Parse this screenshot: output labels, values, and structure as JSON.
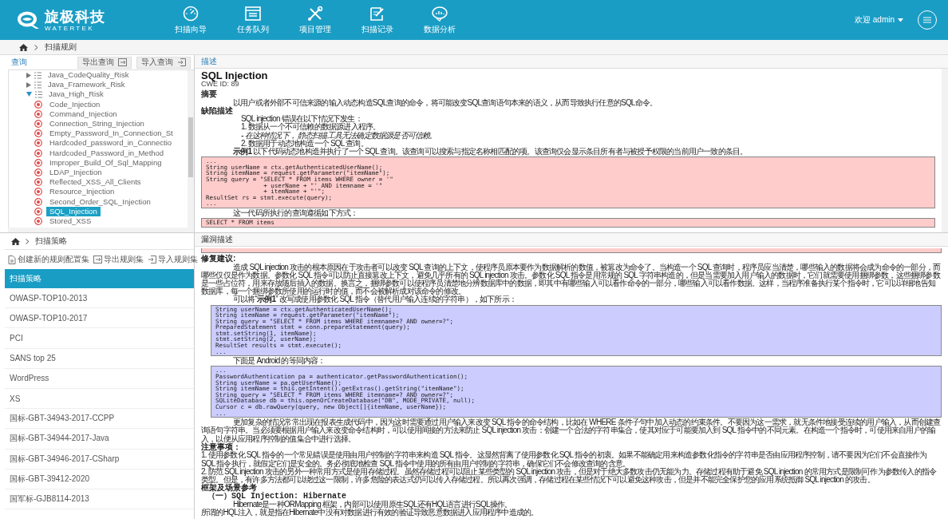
{
  "header": {
    "logo_text": "旋极科技",
    "logo_subtext": "WATERTEK",
    "nav": [
      {
        "label": "扫描向导"
      },
      {
        "label": "任务队列"
      },
      {
        "label": "项目管理"
      },
      {
        "label": "扫描记录"
      },
      {
        "label": "数据分析"
      }
    ],
    "user_menu": "欢迎 admin"
  },
  "breadcrumb": {
    "items": [
      "扫描规则"
    ]
  },
  "rule_tree": {
    "title": "查询",
    "buttons": [
      {
        "label": "导出查询"
      },
      {
        "label": "导入查询"
      }
    ],
    "groups": [
      {
        "label": "Java_CodeQuality_Risk",
        "expanded": false
      },
      {
        "label": "Java_Framework_Risk",
        "expanded": false
      },
      {
        "label": "Java_High_Risk",
        "expanded": true,
        "children": [
          {
            "label": "Code_Injection",
            "selected": false
          },
          {
            "label": "Command_Injection",
            "selected": false
          },
          {
            "label": "Connection_String_Injection",
            "selected": false
          },
          {
            "label": "Empty_Password_In_Connection_St",
            "selected": false
          },
          {
            "label": "Hardcoded_password_in_Connectio",
            "selected": false
          },
          {
            "label": "Hardcoded_Password_in_Method",
            "selected": false
          },
          {
            "label": "Improper_Build_Of_Sql_Mapping",
            "selected": false
          },
          {
            "label": "LDAP_Injection",
            "selected": false
          },
          {
            "label": "Reflected_XSS_All_Clients",
            "selected": false
          },
          {
            "label": "Resource_Injection",
            "selected": false
          },
          {
            "label": "Second_Order_SQL_Injection",
            "selected": false
          },
          {
            "label": "SQL_Injection",
            "selected": true
          },
          {
            "label": "Stored_XSS",
            "selected": false
          }
        ]
      }
    ]
  },
  "description": {
    "tab": "描述",
    "title": "SQL Injection",
    "cwe": "CWE ID: 89",
    "blocks": [
      {
        "kind": "heading",
        "text": "摘要"
      },
      {
        "kind": "para",
        "text": "以用户或者外部不可信来源的输入动态构造SQL查询的命令，将可能改变SQL查询语句本来的语义，从而导致执行任意的SQL命令。"
      },
      {
        "kind": "heading",
        "text": "缺陷描述"
      },
      {
        "kind": "item",
        "text": "SQL injection 错误在以下情况下发生："
      },
      {
        "kind": "item",
        "text": "1. 数据从一个不可信赖的数据源进入程序。"
      },
      {
        "kind": "note",
        "text": "- 在这种情况下， 静态扫描工具无法确定数据源是否可信赖。"
      },
      {
        "kind": "item",
        "text": "2. 数据用于动态地构造一个 SQL 查询。"
      },
      {
        "kind": "para",
        "text": "**示例1** 以下代码动态地构造并执行了一个 SQL 查询。该查询可以搜索与指定名称相匹配的项。该查询仅会显示条目所有者与被授予权限的当前用户一致的条目。"
      },
      {
        "kind": "code_bad",
        "lines": [
          "...",
          "String userName = ctx.getAuthenticatedUserName();",
          "String itemName = request.getParameter(\"itemName\");",
          "String query = \"SELECT * FROM items WHERE owner = '\"",
          "                + userName + \"' AND itemname = '\"",
          "                + itemName + \"'\";",
          "ResultSet rs = stmt.execute(query);",
          "..."
        ]
      },
      {
        "kind": "para",
        "text": "这一代码所执行的查询遵循如下方式："
      },
      {
        "kind": "code_bad",
        "lines": [
          "SELECT * FROM items"
        ]
      }
    ]
  },
  "policy": {
    "breadcrumb": "扫描策略",
    "tools": [
      {
        "label": "创建新的规则配置集"
      },
      {
        "label": "导出规则集"
      },
      {
        "label": "导入规则集"
      }
    ],
    "list_header": "扫描策略",
    "items": [
      "OWASP-TOP10-2013",
      "OWASP-TOP10-2017",
      "PCI",
      "SANS top 25",
      "WordPress",
      "XS",
      "国标-GBT-34943-2017-CCPP",
      "国标-GBT-34944-2017-Java",
      "国标-GBT-34946-2017-CSharp",
      "国标-GBT-39412-2020",
      "国军标-GJB8114-2013"
    ]
  },
  "vulnerability": {
    "tab": "漏洞描述",
    "blocks": [
      {
        "kind": "heading",
        "text": "修复建议:"
      },
      {
        "kind": "para",
        "text": "造成 SQL injection 攻击的根本原因在于攻击者可以改变 SQL 查询的上下文，使程序员原本要作为数据解析的数值，被篡改为命令了。当构造一个 SQL 查询时，程序员应当清楚，哪些输入的数据将会成为命令的一部分，而哪些仅仅是作为数据。参数化 SQL 指令可以防止直接篡改上下文，避免几乎所有的 SQL injection 攻击。参数化 SQL 指令是用常规的 SQL 字符串构造的，但是当需要加入用户输入的数据时，它们就需要使用捆绑参数，这些捆绑参数是一些占位符，用来存放随后插入的数据。换言之，捆绑参数可以使程序员清楚地分辨数据库中的数据，即其中有哪些输入可以看作命令的一部分，哪些输入可以看作数据。这样，当程序准备执行某个指令时，它可以详细地告知数据库，每一个捆绑参数所使用的运行时的值，而不会被解析成对该命令的修改。"
      },
      {
        "kind": "para",
        "text": "可以将“**示例1**” 改写成使用参数化 SQL 指令（替代用户输入连续的字符串），如下所示："
      },
      {
        "kind": "code_good",
        "lines": [
          "String userName = ctx.getAuthenticatedUserName();",
          "String itemName = request.getParameter(\"itemName\");",
          "String query = \"SELECT * FROM items WHERE itemname=? AND owner=?\";",
          "PreparedStatement stmt = conn.prepareStatement(query);",
          "stmt.setString(1, itemName);",
          "stmt.setString(2, userName);",
          "ResultSet results = stmt.execute();",
          "..."
        ]
      },
      {
        "kind": "para",
        "text": "下面是 Android 的等同内容："
      },
      {
        "kind": "code_good",
        "lines": [
          "...",
          "PasswordAuthentication pa = authenticator.getPasswordAuthentication();",
          "String userName = pa.getUserName();",
          "String itemName = this.getIntent().getExtras().getString(\"itemName\");",
          "String query = \"SELECT * FROM items WHERE itemname=? AND owner=?\";",
          "SQLiteDatabase db = this.openOrCreateDatabase(\"DB\", MODE_PRIVATE, null);",
          "Cursor c = db.rawQuery(query, new Object[]{itemName, userName});",
          "..."
        ]
      },
      {
        "kind": "para",
        "text": "更加复杂的情况常常出现在报表生成代码中，因为这时需要通过用户输入来改变 SQL 指令的命令结构，比如在 WHERE 条件子句中加入动态的约束条件。不要因为这一需求，就无条件地接受连续的用户输入，从而创建查询语句字符串。当必须要根据用户输入来改变命令结构时，可以使用间接的方法来防止 SQL injection 攻击：创建一个合法的字符串集合，使其对应于可能要加入到 SQL 指令中的不同元素。在构造一个指令时，可使用来自用户的输入，以便从应用程序控制的值集合中进行选择。"
      },
      {
        "kind": "heading",
        "text": "注意事项："
      },
      {
        "kind": "flush",
        "text": "1. 使用参数化 SQL 指令的一个常见错误是使用由用户控制的字符串来构造 SQL 指令。这显然背离了使用参数化 SQL 指令的初衷。如果不能确定用来构造参数化指令的字符串是否由应用程序控制，请不要因为它们不会直接作为 SQL 指令执行，就假定它们是安全的。务必彻底地检查 SQL 指令中使用的所有由用户控制的字符串，确保它们不会修改查询的含意。"
      },
      {
        "kind": "flush",
        "text": "2. 防范 SQL injection 攻击的另外一种常用方式是使用存储过程。虽然存储过程可以阻止某些类型的 SQL injection 攻击，但是对于绝大多数攻击仍无能为力。存储过程有助于避免 SQL injection 的常用方式是限制可作为参数传入的指令类型。但是，有许多方法都可以绕过这一限制，许多危险的表达式仍可以传入存储过程。所以再次强调，存储过程在某些情况下可以避免这种攻击，但是并不能完全保护您的应用系统抵御 SQL injection 的攻击。"
      },
      {
        "kind": "heading",
        "text": "框架及场景参考"
      },
      {
        "kind": "subheading",
        "text": "（一）SQL Injection: Hibernate"
      },
      {
        "kind": "para",
        "text": "Hibernate是一种ORMapping 框架，内部可以使用原生SQL还有HQL语言进行SQL操作。"
      },
      {
        "kind": "flush",
        "text": "所谓的HQL注入，就是指在Hibernate中没有对数据进行有效的验证导致恶意数据进入应用程序中造成的。"
      }
    ]
  }
}
